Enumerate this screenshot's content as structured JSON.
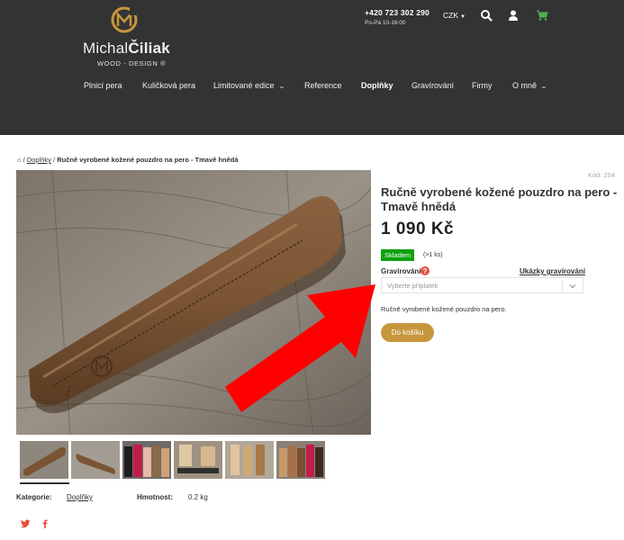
{
  "header": {
    "brand_first": "Michal",
    "brand_last": "Čiliak",
    "brand_sub": "WOOD - DESIGN ®",
    "phone": "+420 723 302 290",
    "hours": "Po-Pá 10-16:00",
    "currency": "CZK",
    "icons": [
      "search-icon",
      "user-icon",
      "cart-icon"
    ],
    "colors": {
      "background": "#333333",
      "logo_gold": "#c7963c",
      "cart_green": "#4caf50"
    }
  },
  "nav": {
    "items": [
      {
        "label": "Plnicí pera"
      },
      {
        "label": "Kuličková pera"
      },
      {
        "label": "Limitované edice",
        "has_dropdown": true
      },
      {
        "label": "Reference"
      },
      {
        "label": "Doplňky",
        "active": true
      },
      {
        "label": "Gravírování"
      },
      {
        "label": "Firmy"
      },
      {
        "label": "O mně",
        "has_dropdown": true
      }
    ]
  },
  "breadcrumb": {
    "home_icon": "home-icon",
    "separator": "/",
    "parent": "Doplňky",
    "current": "Ručně vyrobené kožené pouzdro na pero - Tmavě hnědá"
  },
  "product": {
    "code": "Kód: 204",
    "title": "Ručně vyrobené kožené pouzdro na pero - Tmavě hnědá",
    "price": "1 090 Kč",
    "stock_label": "Skladem",
    "stock_count": "(>1 ks)",
    "engraving_label": "Gravírování",
    "engraving_help_icon": "question-icon",
    "engraving_samples_link": "Ukázky gravírování",
    "select_placeholder": "Vyberte příplatek",
    "description": "Ručně vyrobené kožené pouzdro na pero.",
    "add_to_cart": "Do košíku",
    "colors": {
      "stock": "#0da10d",
      "button": "#c7963c",
      "help": "#e74c3c"
    }
  },
  "gallery": {
    "thumb_count": 6,
    "active_index": 0
  },
  "meta": {
    "category_label": "Kategorie:",
    "category_value": "Doplňky",
    "weight_label": "Hmotnost:",
    "weight_value": "0.2 kg"
  },
  "social": {
    "icons": [
      "twitter-icon",
      "facebook-icon"
    ],
    "color": "#e74c3c"
  },
  "annotation": {
    "arrow_color": "#ff0000"
  }
}
